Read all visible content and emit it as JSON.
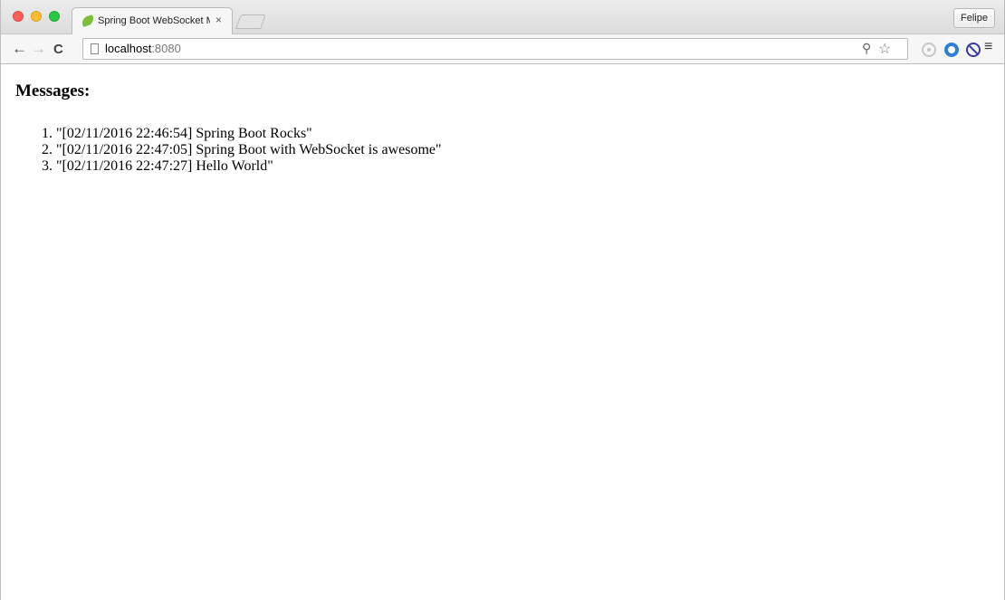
{
  "browser": {
    "tab_title": "Spring Boot WebSocket M",
    "tab_close": "×",
    "profile_name": "Felipe",
    "url_host": "localhost",
    "url_port": ":8080",
    "icons": {
      "back": "back-arrow-icon",
      "forward": "forward-arrow-icon",
      "reload": "reload-icon",
      "page": "page-icon",
      "zoom": "zoom-icon",
      "bookmark": "star-icon",
      "menu": "hamburger-menu-icon"
    }
  },
  "page": {
    "heading": "Messages:",
    "messages": [
      "\"[02/11/2016 22:46:54] Spring Boot Rocks\"",
      "\"[02/11/2016 22:47:05] Spring Boot with WebSocket is awesome\"",
      "\"[02/11/2016 22:47:27] Hello World\""
    ]
  },
  "colors": {
    "close_button": "#fc5f57",
    "minimize_button": "#fdbc2e",
    "maximize_button": "#28c840",
    "extension_blue": "#2f7fd6",
    "extension_block": "#3a3aa0"
  }
}
